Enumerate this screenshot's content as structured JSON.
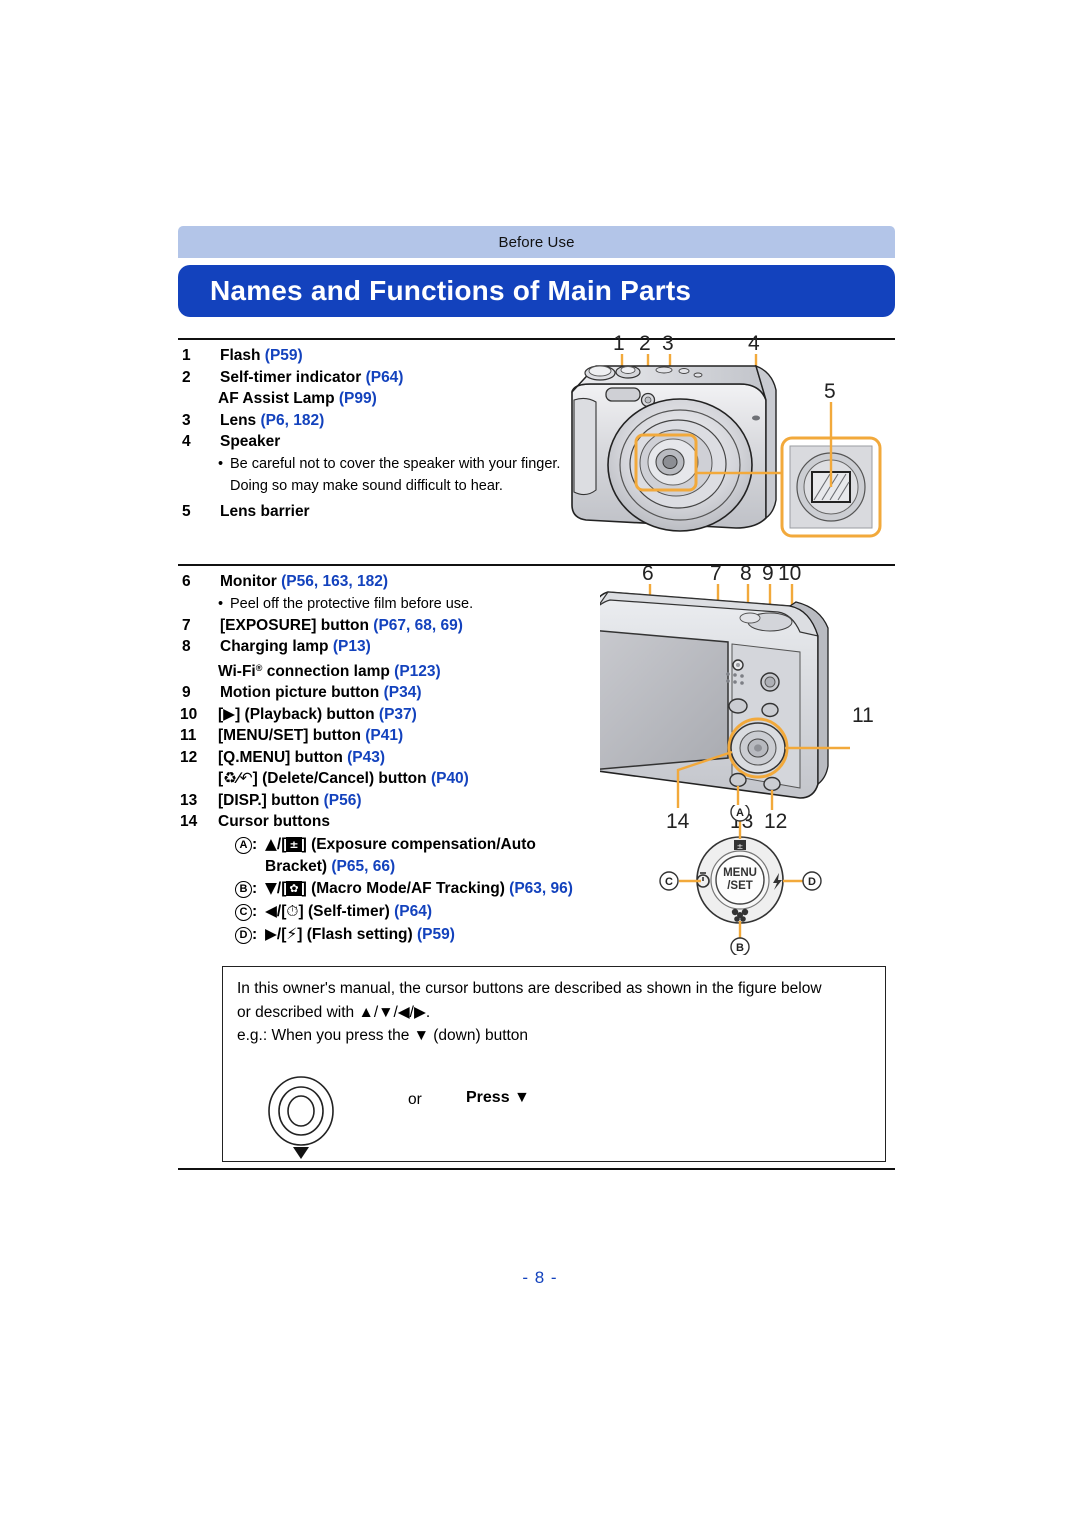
{
  "page": {
    "running_head": "Before Use",
    "title": "Names and Functions of Main Parts",
    "footer": "- 8 -",
    "accent_blue": "#1342bd",
    "head_blue": "#b3c5e8",
    "leader_orange": "#f2a93b"
  },
  "parts_list_top": [
    {
      "num": "1",
      "label": "Flash",
      "refs": "(P59)"
    },
    {
      "num": "2",
      "label": "Self-timer indicator",
      "refs": "(P64)",
      "cont_label": "AF Assist Lamp",
      "cont_refs": "(P99)"
    },
    {
      "num": "3",
      "label": "Lens",
      "refs": "(P6, 182)"
    },
    {
      "num": "4",
      "label": "Speaker",
      "refs": "",
      "bullet": "Be careful not to cover the speaker with your finger. Doing so may make sound difficult to hear."
    },
    {
      "num": "5",
      "label": "Lens barrier",
      "refs": ""
    }
  ],
  "parts_list_bottom": [
    {
      "num": "6",
      "label": "Monitor",
      "refs": "(P56, 163, 182)",
      "bullet": "Peel off the protective film before use."
    },
    {
      "num": "7",
      "label": "[EXPOSURE] button",
      "refs": "(P67, 68, 69)"
    },
    {
      "num": "8",
      "label": "Charging lamp",
      "refs": "(P13)",
      "cont_label": "Wi-Fi connection lamp",
      "cont_refs": "(P123)"
    },
    {
      "num": "9",
      "label": "Motion picture button",
      "refs": "(P34)"
    },
    {
      "num": "10",
      "label": "[▶] (Playback) button",
      "refs": "(P37)"
    },
    {
      "num": "11",
      "label": "[MENU/SET] button",
      "refs": "(P41)"
    },
    {
      "num": "12",
      "label": "[Q.MENU] button",
      "refs": "(P43)",
      "cont_label": "[🗑/↶] (Delete/Cancel) button",
      "cont_refs": "(P40)"
    },
    {
      "num": "13",
      "label": "[DISP.] button",
      "refs": "(P56)"
    },
    {
      "num": "14",
      "label": "Cursor buttons",
      "refs": ""
    }
  ],
  "cursor_items": [
    {
      "tag": "A",
      "text": "▲/[±] (Exposure compensation/Auto",
      "cont": "Bracket)",
      "refs": "(P65, 66)"
    },
    {
      "tag": "B",
      "text": "▼/[✿] (Macro Mode/AF Tracking)",
      "refs": "(P63, 96)"
    },
    {
      "tag": "C",
      "text": "◀/[⏱] (Self-timer)",
      "refs": "(P64)"
    },
    {
      "tag": "D",
      "text": "▶/[⚡] (Flash setting)",
      "refs": "(P59)"
    }
  ],
  "front_view": {
    "callouts": [
      "1",
      "2",
      "3",
      "4",
      "5"
    ]
  },
  "rear_view": {
    "callouts": [
      "6",
      "7",
      "8",
      "9",
      "10",
      "11",
      "12",
      "13",
      "14"
    ]
  },
  "cursor_diagram": {
    "center_label_line1": "MENU",
    "center_label_line2": "/SET",
    "tag_top": "A",
    "tag_bottom": "B",
    "tag_left": "C",
    "tag_right": "D"
  },
  "note": {
    "line1": "In this owner's manual, the cursor buttons are described as shown in the figure below",
    "line2": "or described with ▲/▼/◀/▶.",
    "line3": "e.g.: When you press the ▼ (down) button",
    "or_label": "or",
    "press_label": "Press ▼"
  }
}
